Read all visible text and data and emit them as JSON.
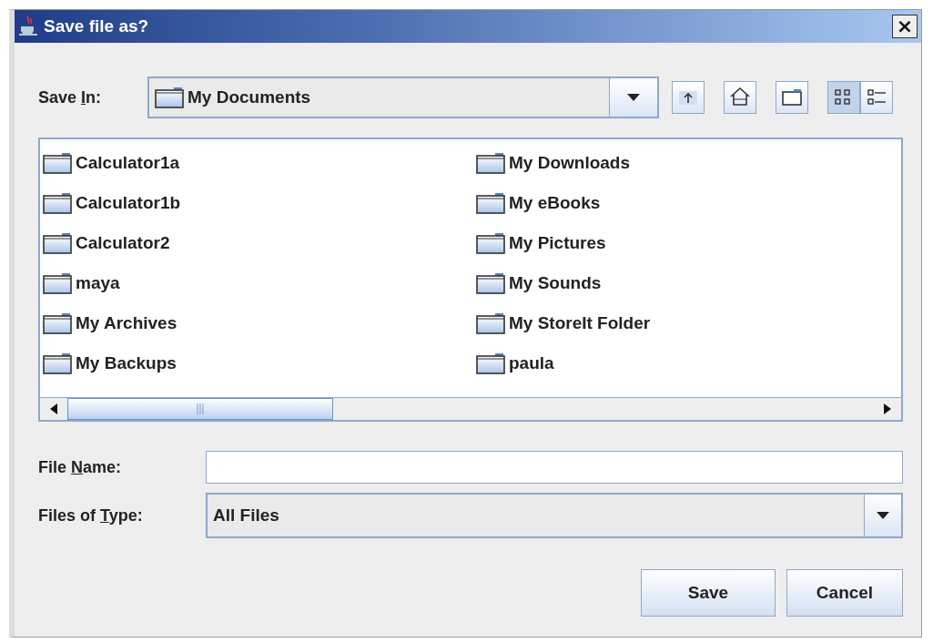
{
  "window": {
    "title": "Save file as?",
    "close": "×"
  },
  "save_in": {
    "label_parts": [
      "Save ",
      "I",
      "n:"
    ],
    "value": "My Documents"
  },
  "toolbar": [
    {
      "kind": "up",
      "selected": false
    },
    {
      "kind": "home",
      "selected": false
    },
    {
      "kind": "newfolder",
      "selected": false
    },
    {
      "kind": "list",
      "selected": true
    },
    {
      "kind": "details",
      "selected": false
    }
  ],
  "files": [
    {
      "name": "Calculator1a"
    },
    {
      "name": "Calculator1b"
    },
    {
      "name": "Calculator2"
    },
    {
      "name": "maya"
    },
    {
      "name": "My Archives"
    },
    {
      "name": "My Backups"
    },
    {
      "name": "My Downloads"
    },
    {
      "name": "My eBooks"
    },
    {
      "name": "My Pictures"
    },
    {
      "name": "My Sounds"
    },
    {
      "name": "My StoreIt Folder"
    },
    {
      "name": "paula"
    }
  ],
  "file_name": {
    "label_parts": [
      "File ",
      "N",
      "ame:"
    ]
  },
  "files_of_type": {
    "label_parts": [
      "Files of ",
      "T",
      "ype:"
    ],
    "value": "All Files"
  },
  "buttons": [
    "Save",
    "Cancel"
  ]
}
